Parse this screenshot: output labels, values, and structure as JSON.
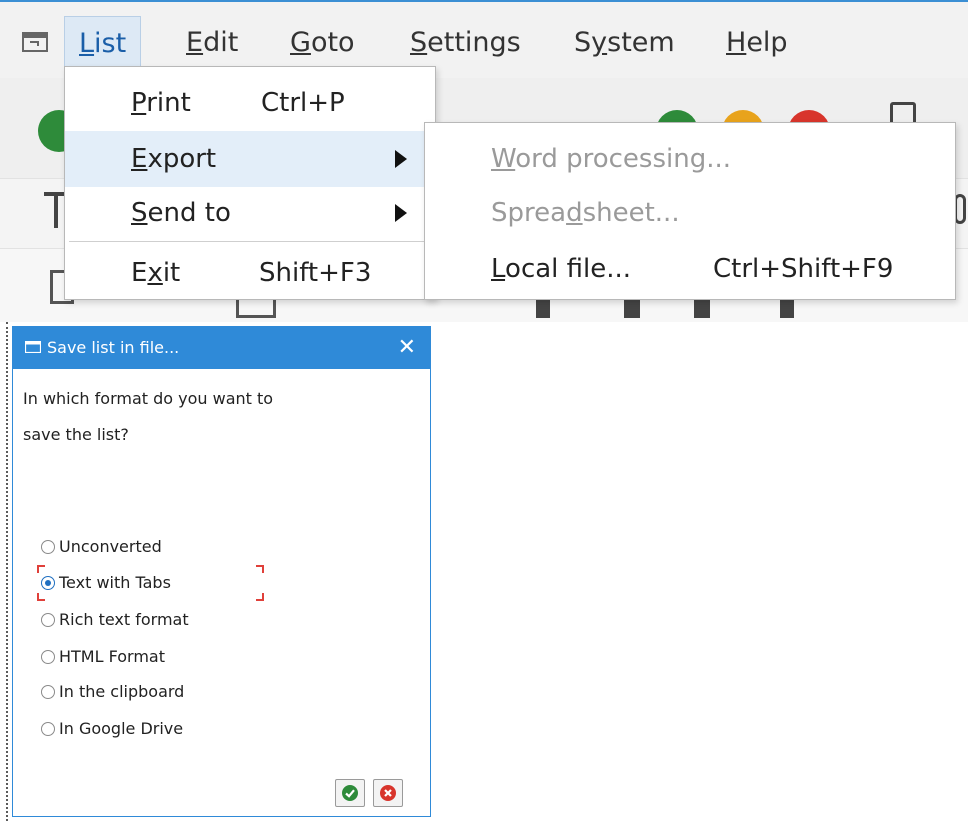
{
  "menubar": {
    "items": [
      {
        "label": "List",
        "mnemonic": "L",
        "rest": "ist",
        "active": true
      },
      {
        "label": "Edit",
        "mnemonic": "E",
        "rest": "dit",
        "active": false
      },
      {
        "label": "Goto",
        "mnemonic": "G",
        "rest": "oto",
        "active": false
      },
      {
        "label": "Settings",
        "mnemonic": "S",
        "rest": "ettings",
        "active": false
      },
      {
        "label": "System",
        "pre": "S",
        "mnemonic": "y",
        "rest": "stem",
        "active": false
      },
      {
        "label": "Help",
        "mnemonic": "H",
        "rest": "elp",
        "active": false
      }
    ]
  },
  "list_menu": {
    "items": [
      {
        "pre": "",
        "mnemonic": "P",
        "rest": "rint",
        "shortcut": "Ctrl+P"
      },
      {
        "pre": "",
        "mnemonic": "E",
        "rest": "xport",
        "shortcut": ""
      },
      {
        "pre": "",
        "mnemonic": "S",
        "rest": "end to",
        "shortcut": ""
      },
      {
        "pre": "E",
        "mnemonic": "x",
        "rest": "it",
        "shortcut": "Shift+F3"
      }
    ]
  },
  "export_submenu": {
    "items": [
      {
        "pre": "",
        "mnemonic": "W",
        "rest": "ord processing...",
        "shortcut": "",
        "disabled": true
      },
      {
        "pre": "Sprea",
        "mnemonic": "d",
        "rest": "sheet...",
        "shortcut": "",
        "disabled": true
      },
      {
        "pre": "",
        "mnemonic": "L",
        "rest": "ocal file...",
        "shortcut": "Ctrl+Shift+F9",
        "disabled": false
      }
    ]
  },
  "dialog": {
    "title": "Save list in file...",
    "close": "✕",
    "question_line1": "In which format do you want to",
    "question_line2": "save the list?",
    "options": [
      {
        "label": "Unconverted",
        "checked": false
      },
      {
        "label": "Text with Tabs",
        "checked": true
      },
      {
        "label": "Rich text format",
        "checked": false
      },
      {
        "label": "HTML Format",
        "checked": false
      },
      {
        "label": "In the clipboard",
        "checked": false
      },
      {
        "label": "In Google Drive",
        "checked": false
      }
    ]
  },
  "colors": {
    "accent_blue": "#2f8ad8",
    "confirm_green": "#2e8b3a",
    "cancel_red": "#d8352c"
  },
  "icons": {
    "menu_app": "window-icon",
    "confirm": "check-icon",
    "cancel": "cancel-icon",
    "submenu_indicator": "caret-right-icon"
  }
}
